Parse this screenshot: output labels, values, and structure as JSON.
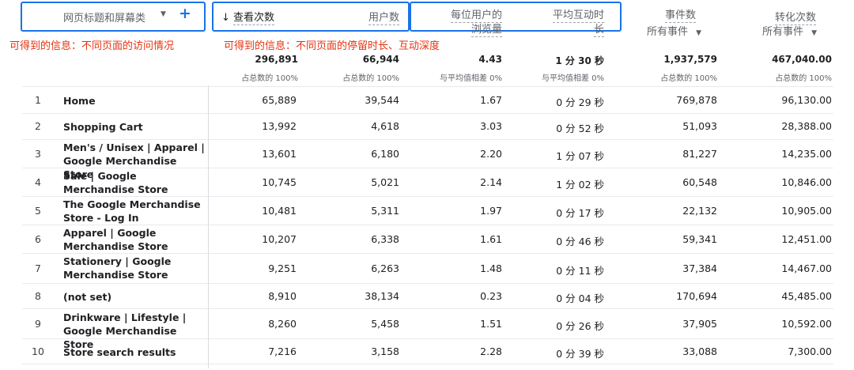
{
  "header": {
    "dim_label": "网页标题和屏幕类",
    "dim_dropdown_icon": "triangle-down",
    "add_dim_icon": "plus",
    "sort_icon": "arrow-down",
    "col_views": "查看次数",
    "col_users": "用户数",
    "col_views_per_user_l1": "每位用户的",
    "col_views_per_user_l2": "浏览量",
    "col_engagement_l1": "平均互动时",
    "col_engagement_l2": "长",
    "col_events": "事件数",
    "col_events_filter": "所有事件",
    "col_conversions": "转化次数",
    "col_conversions_filter": "所有事件"
  },
  "annotations": {
    "left": "可得到的信息：不同页面的访问情况",
    "right": "可得到的信息：不同页面的停留时长、互动深度",
    "highlight_color": "#1a73e8",
    "text_color": "#e8320e"
  },
  "totals": {
    "views": "296,891",
    "views_pct": "占总数的 100%",
    "users": "66,944",
    "users_pct": "占总数的 100%",
    "vpu": "4.43",
    "vpu_pct": "与平均值相差 0%",
    "eng": "1 分 30 秒",
    "eng_pct": "与平均值相差 0%",
    "events": "1,937,579",
    "events_pct": "占总数的 100%",
    "conv": "467,040.00",
    "conv_pct": "占总数的 100%"
  },
  "rows": [
    {
      "i": "1",
      "name": "Home",
      "views": "65,889",
      "users": "39,544",
      "vpu": "1.67",
      "eng": "0 分 29 秒",
      "events": "769,878",
      "conv": "96,130.00"
    },
    {
      "i": "2",
      "name": "Shopping Cart",
      "views": "13,992",
      "users": "4,618",
      "vpu": "3.03",
      "eng": "0 分 52 秒",
      "events": "51,093",
      "conv": "28,388.00"
    },
    {
      "i": "3",
      "name": "Men's / Unisex | Apparel | Google Merchandise Store",
      "views": "13,601",
      "users": "6,180",
      "vpu": "2.20",
      "eng": "1 分 07 秒",
      "events": "81,227",
      "conv": "14,235.00"
    },
    {
      "i": "4",
      "name": "Sale | Google Merchandise Store",
      "views": "10,745",
      "users": "5,021",
      "vpu": "2.14",
      "eng": "1 分 02 秒",
      "events": "60,548",
      "conv": "10,846.00"
    },
    {
      "i": "5",
      "name": "The Google Merchandise Store - Log In",
      "views": "10,481",
      "users": "5,311",
      "vpu": "1.97",
      "eng": "0 分 17 秒",
      "events": "22,132",
      "conv": "10,905.00"
    },
    {
      "i": "6",
      "name": "Apparel | Google Merchandise Store",
      "views": "10,207",
      "users": "6,338",
      "vpu": "1.61",
      "eng": "0 分 46 秒",
      "events": "59,341",
      "conv": "12,451.00"
    },
    {
      "i": "7",
      "name": "Stationery | Google Merchandise Store",
      "views": "9,251",
      "users": "6,263",
      "vpu": "1.48",
      "eng": "0 分 11 秒",
      "events": "37,384",
      "conv": "14,467.00"
    },
    {
      "i": "8",
      "name": "(not set)",
      "views": "8,910",
      "users": "38,134",
      "vpu": "0.23",
      "eng": "0 分 04 秒",
      "events": "170,694",
      "conv": "45,485.00"
    },
    {
      "i": "9",
      "name": "Drinkware | Lifestyle | Google Merchandise Store",
      "views": "8,260",
      "users": "5,458",
      "vpu": "1.51",
      "eng": "0 分 26 秒",
      "events": "37,905",
      "conv": "10,592.00"
    },
    {
      "i": "10",
      "name": "Store search results",
      "views": "7,216",
      "users": "3,158",
      "vpu": "2.28",
      "eng": "0 分 39 秒",
      "events": "33,088",
      "conv": "7,300.00"
    }
  ]
}
